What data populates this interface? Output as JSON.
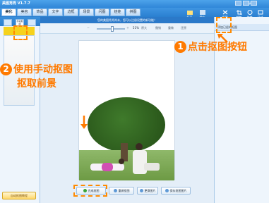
{
  "app": {
    "title": "美图秀秀 V1.7.7"
  },
  "menu": [
    {
      "label": "美化",
      "active": true
    },
    {
      "label": "美容",
      "active": false
    },
    {
      "label": "饰品",
      "active": false
    },
    {
      "label": "文字",
      "active": false
    },
    {
      "label": "边框",
      "active": false
    },
    {
      "label": "场景",
      "active": false
    },
    {
      "label": "闪图",
      "active": false
    },
    {
      "label": "娃娃",
      "active": false
    },
    {
      "label": "拼图",
      "active": false
    }
  ],
  "toolbar": {
    "open": "打开",
    "save": "保存",
    "cutout": "抠图",
    "crop": "裁剪",
    "rotate": "旋转",
    "size": "尺寸",
    "login": "登录"
  },
  "status_text": "您的美图秀秀尚未，您可以注册设置的新功能！",
  "zoom": {
    "value": "51%",
    "label1": "原大",
    "label2": "撤销",
    "label3": "重做",
    "label4": "还原"
  },
  "right_panel": {
    "header": "添加已经的抠图"
  },
  "left_panel": {
    "tab_active": "手动抠图",
    "auto_button": "自动抠图教程"
  },
  "bottom_buttons": {
    "finish": "完成抠图",
    "redo": "重做抠图",
    "change": "更换图片",
    "save": "保存抠图图片"
  },
  "callouts": {
    "step1_num": "1",
    "step1_text": "点击抠图按钮",
    "step2_num": "2",
    "step2_line1": "使用手动抠图",
    "step2_line2": "抠取前景"
  },
  "colors": {
    "accent": "#ff7a00",
    "titlebar": "#2f86d8"
  }
}
